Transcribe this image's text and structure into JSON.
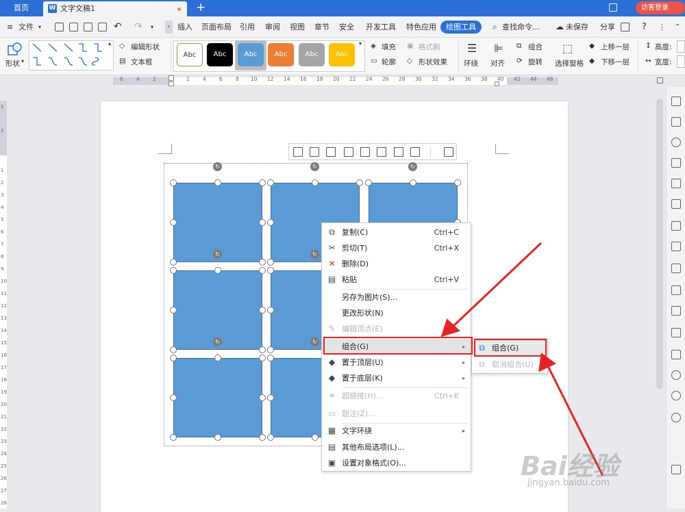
{
  "tabs": {
    "home": "首页",
    "doc_title": "文字文稿1",
    "doc_icon": "W",
    "visitor_login": "访客登录",
    "new_tab": "+"
  },
  "menu": {
    "file": "文件",
    "items": [
      "插入",
      "页面布局",
      "引用",
      "审阅",
      "视图",
      "章节",
      "安全",
      "开发工具",
      "特色应用"
    ],
    "active": "绘图工具",
    "search": "查找命令...",
    "unsaved": "未保存",
    "share": "分享",
    "help": "?"
  },
  "ribbon": {
    "shape": "形状",
    "edit_shape": "编辑形状",
    "text_box": "文本框",
    "style_sample": "Abc",
    "fill": "填充",
    "format_brush": "格式刷",
    "outline": "轮廓",
    "shape_effects": "形状效果",
    "wrap": "环绕",
    "align": "对齐",
    "group": "组合",
    "rotate": "旋转",
    "selection_pane": "选择窗格",
    "bring_forward": "上移一层",
    "send_backward": "下移一层",
    "height": "高度:",
    "width": "宽度:"
  },
  "ruler": {
    "h_left": [
      "6",
      "4",
      "2"
    ],
    "h_right": [
      "2",
      "4",
      "6",
      "8",
      "10",
      "12",
      "14",
      "16",
      "18",
      "20",
      "22",
      "24",
      "26",
      "28",
      "30",
      "32",
      "34",
      "36",
      "38",
      "40",
      "42",
      "44",
      "46"
    ],
    "v": [
      "1",
      "2",
      "1",
      "2",
      "3",
      "4",
      "5",
      "6",
      "7",
      "8",
      "9",
      "10",
      "11",
      "12",
      "13",
      "14",
      "15",
      "16",
      "17",
      "18",
      "19",
      "20",
      "21",
      "22",
      "23",
      "24",
      "25",
      "26",
      "27",
      "28"
    ]
  },
  "context_menu": {
    "items": [
      {
        "label": "复制(C)",
        "shortcut": "Ctrl+C"
      },
      {
        "label": "剪切(T)",
        "shortcut": "Ctrl+X"
      },
      {
        "label": "删除(D)",
        "shortcut": ""
      },
      {
        "label": "粘贴",
        "shortcut": "Ctrl+V"
      },
      {
        "label": "另存为图片(S)...",
        "shortcut": ""
      },
      {
        "label": "更改形状(N)",
        "shortcut": ""
      },
      {
        "label": "编辑顶点(E)",
        "shortcut": ""
      },
      {
        "label": "组合(G)",
        "shortcut": ""
      },
      {
        "label": "置于顶层(U)",
        "shortcut": ""
      },
      {
        "label": "置于底层(K)",
        "shortcut": ""
      },
      {
        "label": "超链接(H)...",
        "shortcut": "Ctrl+K"
      },
      {
        "label": "题注(Z)...",
        "shortcut": ""
      },
      {
        "label": "文字环绕",
        "shortcut": ""
      },
      {
        "label": "其他布局选项(L)...",
        "shortcut": ""
      },
      {
        "label": "设置对象格式(O)...",
        "shortcut": ""
      }
    ]
  },
  "submenu": {
    "group": "组合(G)",
    "ungroup": "取消组合(U)"
  },
  "watermark": {
    "brand": "Bai经验",
    "url": "jingyan.baidu.com"
  },
  "colors": {
    "accent": "#2c6fd6",
    "shape_fill": "#5b9bd5",
    "highlight_red": "#e52323"
  }
}
